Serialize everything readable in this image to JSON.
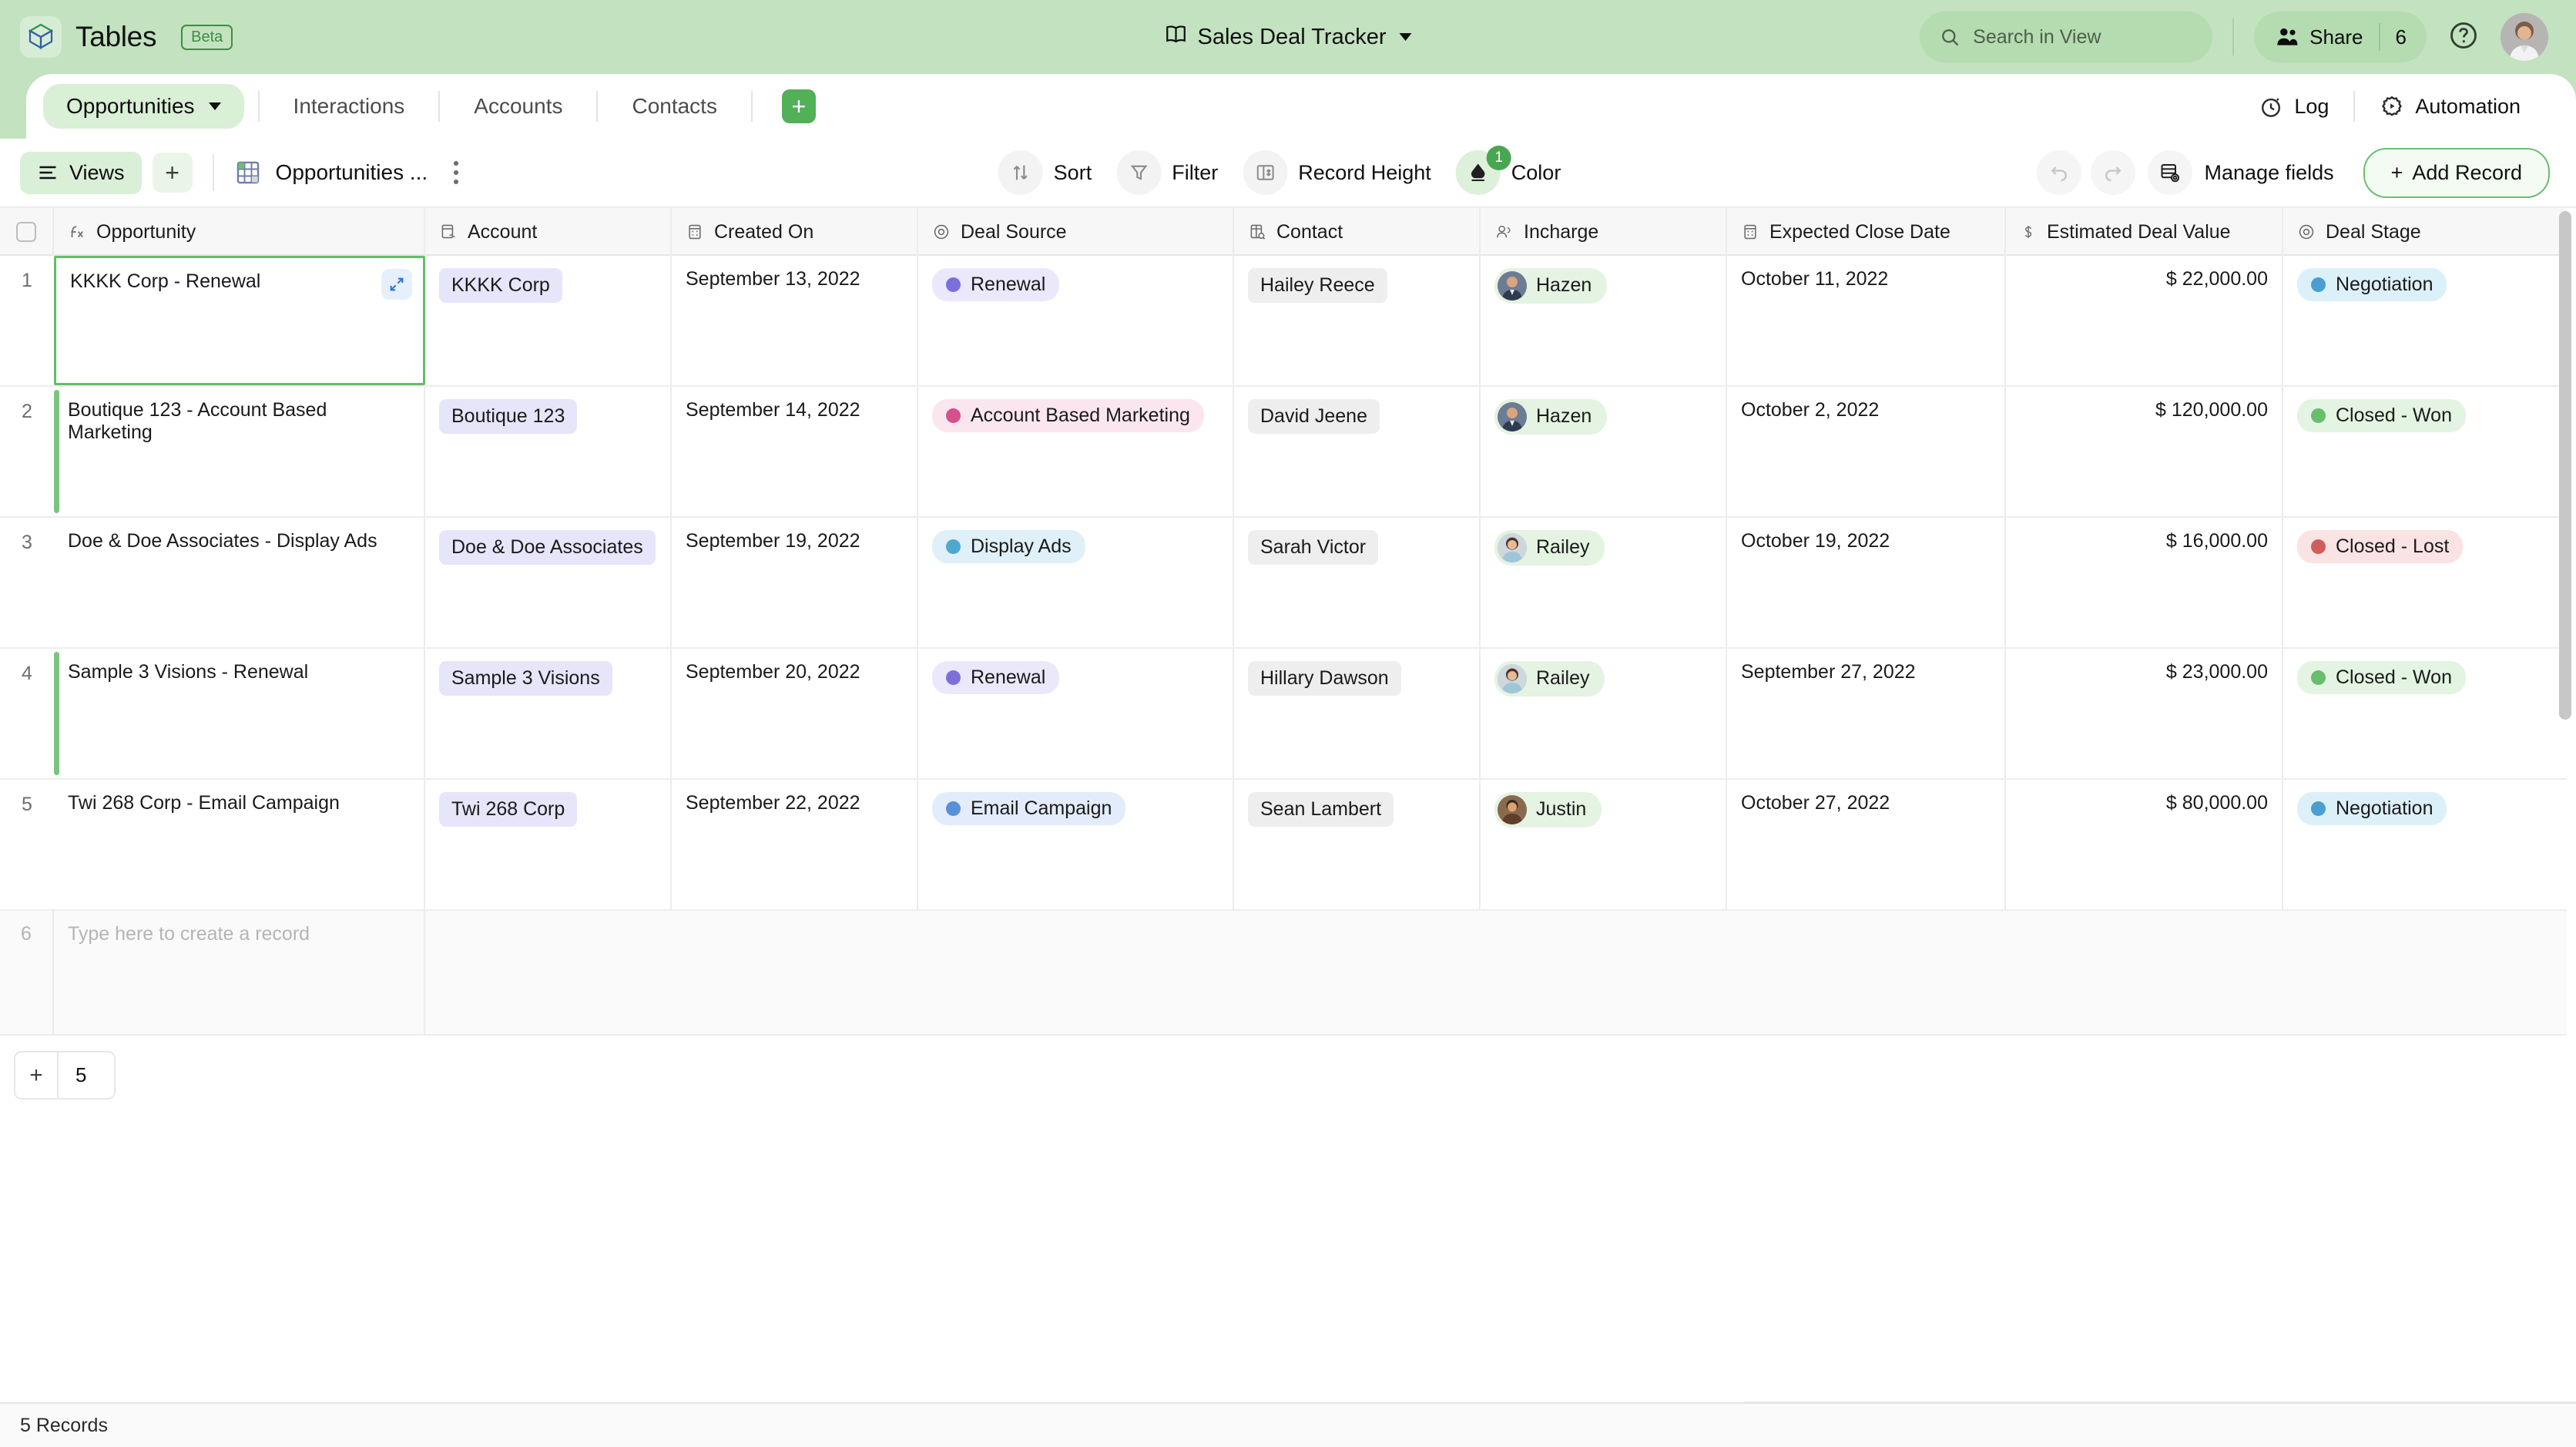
{
  "header": {
    "brand_name": "Tables",
    "beta_label": "Beta",
    "logo_icon": "cube-logo-icon",
    "doc_title": "Sales Deal Tracker",
    "doc_icon": "book-icon",
    "search_placeholder": "Search in View",
    "search_icon": "search-icon",
    "share_label": "Share",
    "share_count": "6",
    "share_icon": "people-icon",
    "help_icon": "question-circle-icon",
    "avatar": "user-avatar"
  },
  "tabs": {
    "items": [
      {
        "label": "Opportunities",
        "active": true,
        "caret": "chevron-down-icon"
      },
      {
        "label": "Interactions",
        "active": false
      },
      {
        "label": "Accounts",
        "active": false
      },
      {
        "label": "Contacts",
        "active": false
      }
    ],
    "add_label": "+",
    "log_label": "Log",
    "log_icon": "stopwatch-icon",
    "automation_label": "Automation",
    "automation_icon": "automation-gear-icon"
  },
  "toolbar": {
    "views_label": "Views",
    "views_icon": "list-lines-icon",
    "add_view_label": "+",
    "view_name": "Opportunities ...",
    "view_icon": "grid-table-icon",
    "kebab_icon": "more-vertical-icon",
    "sort_label": "Sort",
    "sort_icon": "sort-arrows-icon",
    "filter_label": "Filter",
    "filter_icon": "funnel-icon",
    "record_height_label": "Record Height",
    "record_height_icon": "row-height-icon",
    "color_label": "Color",
    "color_icon": "paint-drop-icon",
    "color_badge": "1",
    "undo_icon": "undo-arrow-icon",
    "redo_icon": "redo-arrow-icon",
    "manage_fields_label": "Manage fields",
    "manage_fields_icon": "fields-gear-icon",
    "add_record_label": "Add Record",
    "add_record_plus": "+"
  },
  "grid": {
    "select_all_checkbox": "",
    "columns": [
      {
        "label": "Opportunity",
        "icon": "formula-fx-icon"
      },
      {
        "label": "Account",
        "icon": "link-record-icon"
      },
      {
        "label": "Created On",
        "icon": "calendar-icon"
      },
      {
        "label": "Deal Source",
        "icon": "single-select-icon"
      },
      {
        "label": "Contact",
        "icon": "lookup-icon"
      },
      {
        "label": "Incharge",
        "icon": "collaborator-icon"
      },
      {
        "label": "Expected Close Date",
        "icon": "calendar-icon"
      },
      {
        "label": "Estimated Deal Value",
        "icon": "currency-dollar-icon"
      },
      {
        "label": "Deal Stage",
        "icon": "single-select-icon"
      }
    ],
    "rows": [
      {
        "num": "1",
        "opportunity": "KKKK Corp - Renewal",
        "account": "KKKK Corp",
        "created_on": "September 13, 2022",
        "deal_source": "Renewal",
        "deal_source_color": "#7c6fdc",
        "deal_source_bg": "#ebe8fb",
        "contact": "Hailey Reece",
        "incharge": "Hazen",
        "expected_close_date": "October 11, 2022",
        "estimated_deal_value": "$ 22,000.00",
        "deal_stage": "Negotiation",
        "deal_stage_color": "#4a9ed1",
        "deal_stage_bg": "#dcf0f9",
        "selected": true,
        "marked": false
      },
      {
        "num": "2",
        "opportunity": "Boutique 123 - Account Based Marketing",
        "account": "Boutique 123",
        "created_on": "September 14, 2022",
        "deal_source": "Account Based Marketing",
        "deal_source_color": "#d4518c",
        "deal_source_bg": "#fbe6ef",
        "contact": "David Jeene",
        "incharge": "Hazen",
        "expected_close_date": "October 2, 2022",
        "estimated_deal_value": "$ 120,000.00",
        "deal_stage": "Closed - Won",
        "deal_stage_color": "#68bd6e",
        "deal_stage_bg": "#e3f4e2",
        "selected": false,
        "marked": true
      },
      {
        "num": "3",
        "opportunity": "Doe & Doe Associates - Display Ads",
        "account": "Doe & Doe Associates",
        "created_on": "September 19, 2022",
        "deal_source": "Display Ads",
        "deal_source_color": "#4fa8cf",
        "deal_source_bg": "#dff0f8",
        "contact": "Sarah Victor",
        "incharge": "Railey",
        "expected_close_date": "October 19, 2022",
        "estimated_deal_value": "$ 16,000.00",
        "deal_stage": "Closed - Lost",
        "deal_stage_color": "#cf5d5d",
        "deal_stage_bg": "#f9e3e3",
        "selected": false,
        "marked": false
      },
      {
        "num": "4",
        "opportunity": "Sample 3 Visions - Renewal",
        "account": "Sample 3 Visions",
        "created_on": "September 20, 2022",
        "deal_source": "Renewal",
        "deal_source_color": "#7c6fdc",
        "deal_source_bg": "#ebe8fb",
        "contact": "Hillary Dawson",
        "incharge": "Railey",
        "expected_close_date": "September 27, 2022",
        "estimated_deal_value": "$ 23,000.00",
        "deal_stage": "Closed - Won",
        "deal_stage_color": "#68bd6e",
        "deal_stage_bg": "#e3f4e2",
        "selected": false,
        "marked": true
      },
      {
        "num": "5",
        "opportunity": "Twi 268 Corp - Email Campaign",
        "account": "Twi 268 Corp",
        "created_on": "September 22, 2022",
        "deal_source": "Email Campaign",
        "deal_source_color": "#5b8ed8",
        "deal_source_bg": "#e2ecfa",
        "contact": "Sean Lambert",
        "incharge": "Justin",
        "expected_close_date": "October 27, 2022",
        "estimated_deal_value": "$ 80,000.00",
        "deal_stage": "Negotiation",
        "deal_stage_color": "#4a9ed1",
        "deal_stage_bg": "#dcf0f9",
        "selected": false,
        "marked": false
      }
    ],
    "new_row": {
      "num": "6",
      "placeholder": "Type here to create a record"
    },
    "footer": {
      "add_icon": "+",
      "record_count": "5"
    }
  },
  "status": {
    "text": "5 Records"
  },
  "colors": {
    "header_bg": "#c3e2c0",
    "accent_green": "#51b058",
    "selection_green": "#62bd68"
  }
}
